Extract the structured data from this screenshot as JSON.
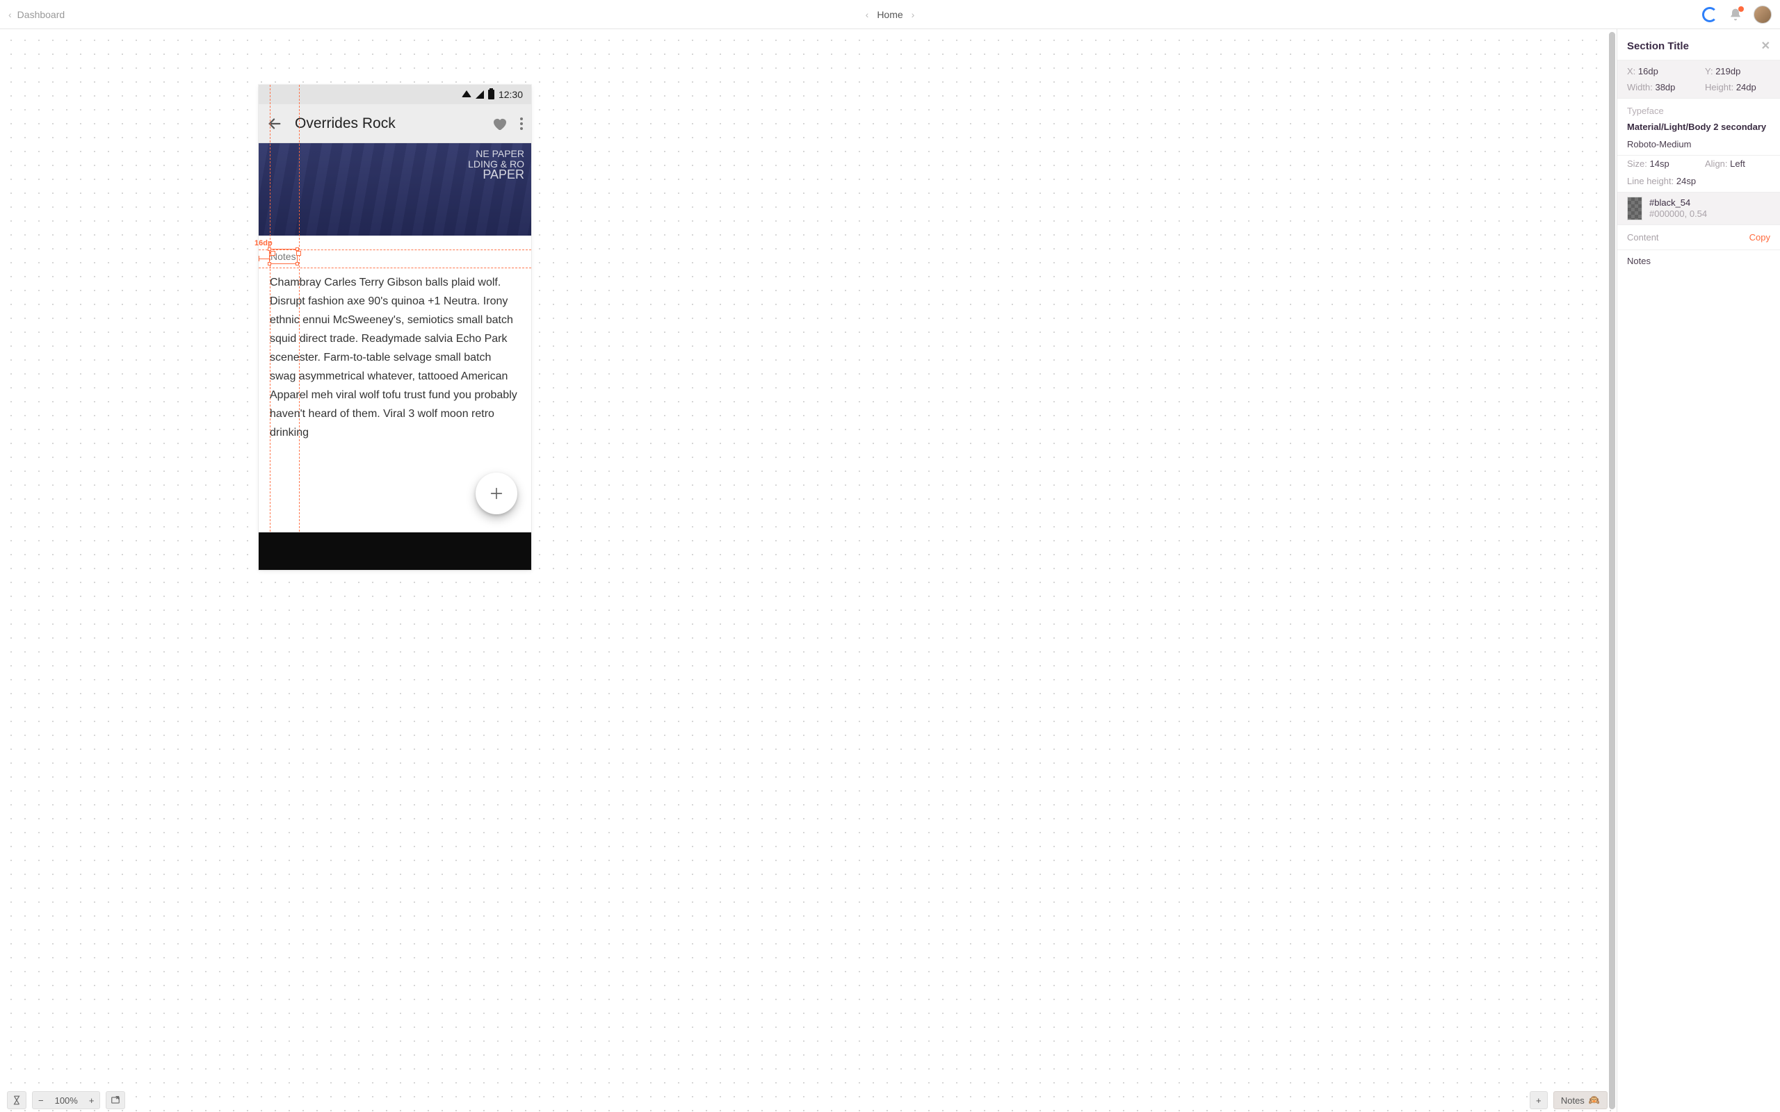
{
  "topbar": {
    "back_label": "Dashboard",
    "breadcrumb": "Home"
  },
  "artboard": {
    "status_time": "12:30",
    "appbar_title": "Overrides Rock",
    "hero_wall_line1": "NE PAPER",
    "hero_wall_line2": "LDING & RO",
    "hero_wall_line3": "PAPER",
    "section_heading": "Notes",
    "body_copy": "Chambray Carles Terry Gibson balls plaid wolf. Disrupt fashion axe 90's quinoa +1 Neutra. Irony ethnic ennui McSweeney's, semiotics small batch squid direct trade. Readymade salvia Echo Park scenester. Farm-to-table selvage small batch swag asymmetrical whatever, tattooed American Apparel meh viral wolf tofu trust fund you probably haven't heard of them. Viral 3 wolf moon retro drinking",
    "measure_label": "16dp"
  },
  "inspector": {
    "title": "Section Title",
    "x_label": "X:",
    "x_val": "16dp",
    "y_label": "Y:",
    "y_val": "219dp",
    "w_label": "Width:",
    "w_val": "38dp",
    "h_label": "Height:",
    "h_val": "24dp",
    "typeface_label": "Typeface",
    "type_style_name": "Material/Light/Body 2 secondary",
    "font_family": "Roboto-Medium",
    "size_label": "Size:",
    "size_val": "14sp",
    "align_label": "Align:",
    "align_val": "Left",
    "lh_label": "Line height:",
    "lh_val": "24sp",
    "color_name": "#black_54",
    "color_hex": "#000000, 0.54",
    "content_label": "Content",
    "copy_label": "Copy",
    "content_value": "Notes"
  },
  "bottombar": {
    "zoom": "100%",
    "notes_label": "Notes",
    "notes_emoji": "🙉"
  }
}
